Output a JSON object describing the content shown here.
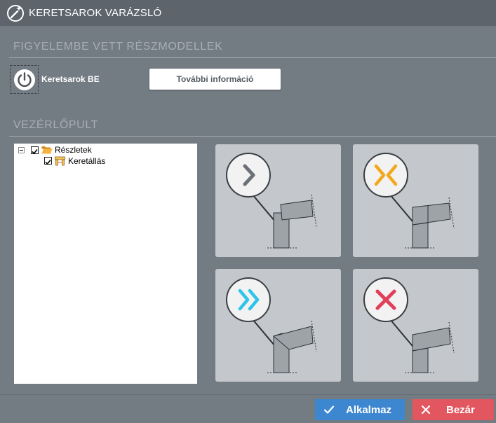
{
  "window": {
    "title": "KERETSAROK VARÁZSLÓ",
    "app_icon": "wizard-icon"
  },
  "sections": {
    "submodels_header": "FIGYELEMBE VETT RÉSZMODELLEK",
    "control_header": "VEZÉRLŐPULT"
  },
  "submodel": {
    "toggle_label": "Keretsarok BE",
    "toggle_icon": "power-icon",
    "info_button": "További információ"
  },
  "tree": {
    "root": {
      "label": "Részletek",
      "checked": true,
      "expanded": true,
      "icon": "folder-open-icon"
    },
    "children": [
      {
        "label": "Keretállás",
        "checked": true,
        "icon": "frame-icon"
      }
    ]
  },
  "actions": [
    {
      "name": "next",
      "icon": "chevron-right-icon",
      "color": "#6b7177"
    },
    {
      "name": "adjust",
      "icon": "chevrons-converge-icon",
      "color": "#f2a81d"
    },
    {
      "name": "skip",
      "icon": "double-chevron-right-icon",
      "color": "#2fc4ea"
    },
    {
      "name": "remove",
      "icon": "x-icon",
      "color": "#e0405a"
    }
  ],
  "footer": {
    "apply_label": "Alkalmaz",
    "close_label": "Bezár",
    "apply_color": "#3d86d0",
    "close_color": "#e2575f"
  }
}
